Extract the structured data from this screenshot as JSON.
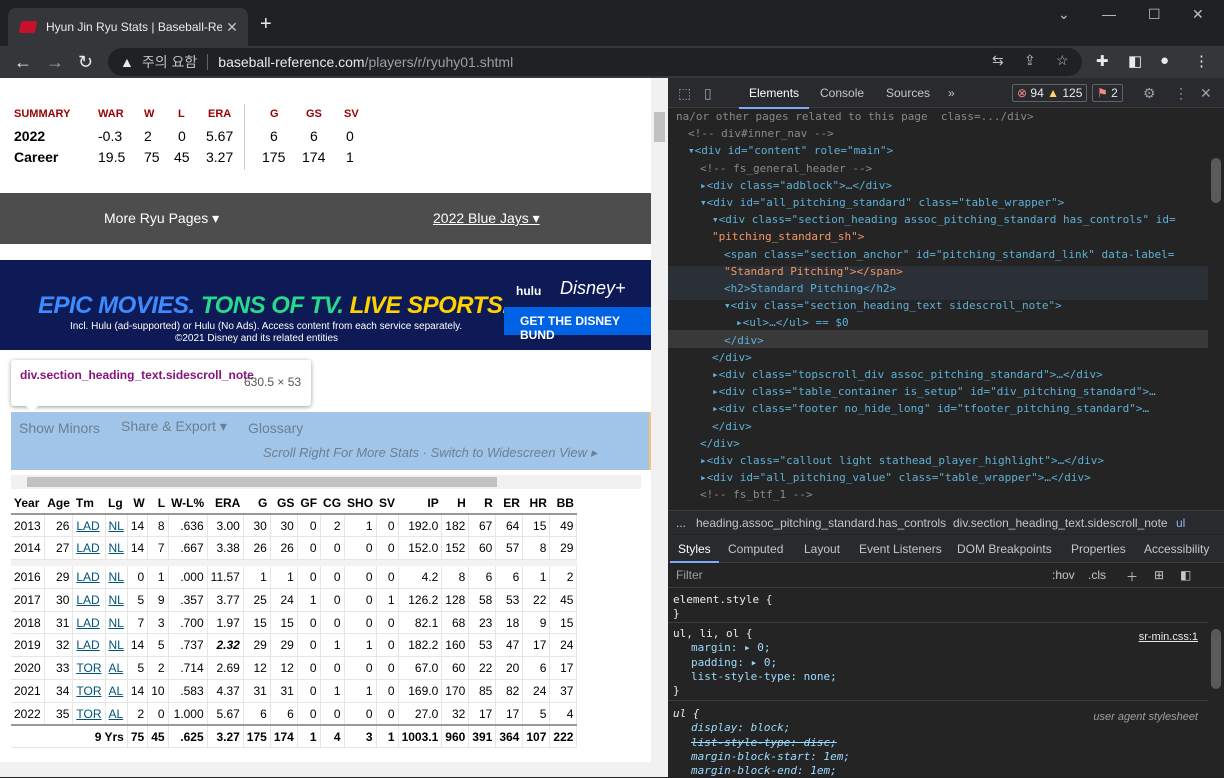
{
  "browser": {
    "tab_title": "Hyun Jin Ryu Stats | Baseball-Re",
    "new_tab": "+",
    "security_label": "주의 요함",
    "url_domain": "baseball-reference.com",
    "url_path": "/players/r/ryuhy01.shtml"
  },
  "summary": {
    "headers": [
      "SUMMARY",
      "WAR",
      "W",
      "L",
      "ERA",
      "G",
      "GS",
      "SV"
    ],
    "rows": [
      [
        "2022",
        "-0.3",
        "2",
        "0",
        "5.67",
        "6",
        "6",
        "0"
      ],
      [
        "Career",
        "19.5",
        "75",
        "45",
        "3.27",
        "175",
        "174",
        "1"
      ]
    ]
  },
  "more": {
    "ryu": "More Ryu Pages ▾",
    "team": "2022 Blue Jays ▾"
  },
  "ad": {
    "epic": "EPIC MOVIES.",
    "tv": "TONS OF TV.",
    "sports": "LIVE SPORTS.",
    "sub1": "Incl. Hulu (ad-supported) or Hulu (No Ads). Access content from each service separately.",
    "sub2": "©2021 Disney and its related entities",
    "hulu": "hulu",
    "disney": "Disney+",
    "cta": "GET THE DISNEY BUND"
  },
  "tooltip": {
    "selector": "div.section_heading_text.sidescroll_note",
    "size": "630.5 × 53"
  },
  "section": {
    "show_minors": "Show Minors",
    "share": "Share & Export ▾",
    "glossary": "Glossary",
    "scroll_note": "Scroll Right For More Stats · Switch to Widescreen View  ▸"
  },
  "table": {
    "headers": [
      "Year",
      "Age",
      "Tm",
      "Lg",
      "W",
      "L",
      "W-L%",
      "ERA",
      "G",
      "GS",
      "GF",
      "CG",
      "SHO",
      "SV",
      "IP",
      "H",
      "R",
      "ER",
      "HR",
      "BB"
    ],
    "rows": [
      [
        "2013",
        "26",
        "LAD",
        "NL",
        "14",
        "8",
        ".636",
        "3.00",
        "30",
        "30",
        "0",
        "2",
        "1",
        "0",
        "192.0",
        "182",
        "67",
        "64",
        "15",
        "49"
      ],
      [
        "2014",
        "27",
        "LAD",
        "NL",
        "14",
        "7",
        ".667",
        "3.38",
        "26",
        "26",
        "0",
        "0",
        "0",
        "0",
        "152.0",
        "152",
        "60",
        "57",
        "8",
        "29"
      ],
      [
        "2016",
        "29",
        "LAD",
        "NL",
        "0",
        "1",
        ".000",
        "11.57",
        "1",
        "1",
        "0",
        "0",
        "0",
        "0",
        "4.2",
        "8",
        "6",
        "6",
        "1",
        "2"
      ],
      [
        "2017",
        "30",
        "LAD",
        "NL",
        "5",
        "9",
        ".357",
        "3.77",
        "25",
        "24",
        "1",
        "0",
        "0",
        "1",
        "126.2",
        "128",
        "58",
        "53",
        "22",
        "45"
      ],
      [
        "2018",
        "31",
        "LAD",
        "NL",
        "7",
        "3",
        ".700",
        "1.97",
        "15",
        "15",
        "0",
        "0",
        "0",
        "0",
        "82.1",
        "68",
        "23",
        "18",
        "9",
        "15"
      ],
      [
        "2019",
        "32",
        "LAD",
        "NL",
        "14",
        "5",
        ".737",
        "2.32",
        "29",
        "29",
        "0",
        "1",
        "1",
        "0",
        "182.2",
        "160",
        "53",
        "47",
        "17",
        "24"
      ],
      [
        "2020",
        "33",
        "TOR",
        "AL",
        "5",
        "2",
        ".714",
        "2.69",
        "12",
        "12",
        "0",
        "0",
        "0",
        "0",
        "67.0",
        "60",
        "22",
        "20",
        "6",
        "17"
      ],
      [
        "2021",
        "34",
        "TOR",
        "AL",
        "14",
        "10",
        ".583",
        "4.37",
        "31",
        "31",
        "0",
        "1",
        "1",
        "0",
        "169.0",
        "170",
        "85",
        "82",
        "24",
        "37"
      ],
      [
        "2022",
        "35",
        "TOR",
        "AL",
        "2",
        "0",
        "1.000",
        "5.67",
        "6",
        "6",
        "0",
        "0",
        "0",
        "0",
        "27.0",
        "32",
        "17",
        "17",
        "5",
        "4"
      ]
    ],
    "totals": [
      "9 Yrs",
      "75",
      "45",
      ".625",
      "3.27",
      "175",
      "174",
      "1",
      "4",
      "3",
      "1",
      "1003.1",
      "960",
      "391",
      "364",
      "107",
      "222"
    ]
  },
  "devtools": {
    "tabs": [
      "Elements",
      "Console",
      "Sources",
      "»"
    ],
    "errors": "94",
    "warnings": "125",
    "issues": "2",
    "lines": [
      {
        "i": 0,
        "t": "na/or other pages related to this page  class=.../div>",
        "k": "cm"
      },
      {
        "i": 1,
        "t": "<!-- div#inner_nav -->",
        "k": "cm"
      },
      {
        "i": 1,
        "t": "▾<div id=\"content\" role=\"main\">",
        "k": "tg"
      },
      {
        "i": 2,
        "t": "<!-- fs_general_header -->",
        "k": "cm"
      },
      {
        "i": 2,
        "t": "▸<div class=\"adblock\">…</div>",
        "k": "tg"
      },
      {
        "i": 2,
        "t": "▾<div id=\"all_pitching_standard\" class=\"table_wrapper\">",
        "k": "tg"
      },
      {
        "i": 3,
        "t": "▾<div class=\"section_heading assoc_pitching_standard has_controls\" id=",
        "k": "tg"
      },
      {
        "i": 3,
        "t": "\"pitching_standard_sh\">",
        "k": "av"
      },
      {
        "i": 4,
        "t": "<span class=\"section_anchor\" id=\"pitching_standard_link\" data-label=",
        "k": "tg"
      },
      {
        "i": 4,
        "t": "\"Standard Pitching\"></span>",
        "k": "av"
      },
      {
        "i": 4,
        "t": "<h2>Standard Pitching</h2>",
        "k": "tg"
      },
      {
        "i": 4,
        "t": "▾<div class=\"section_heading_text sidescroll_note\">",
        "k": "tg"
      },
      {
        "i": 5,
        "t": "▸<ul>…</ul> == $0",
        "k": "tg"
      },
      {
        "i": 4,
        "t": "</div>",
        "k": "tg"
      },
      {
        "i": 3,
        "t": "</div>",
        "k": "tg"
      },
      {
        "i": 3,
        "t": "▸<div class=\"topscroll_div assoc_pitching_standard\">…</div>",
        "k": "tg"
      },
      {
        "i": 3,
        "t": "▸<div class=\"table_container is_setup\" id=\"div_pitching_standard\">…",
        "k": "tg"
      },
      {
        "i": 3,
        "t": "▸<div class=\"footer no_hide_long\" id=\"tfooter_pitching_standard\">…",
        "k": "tg"
      },
      {
        "i": 3,
        "t": "</div>",
        "k": "tg"
      },
      {
        "i": 2,
        "t": "</div>",
        "k": "tg"
      },
      {
        "i": 2,
        "t": "▸<div class=\"callout light stathead_player_highlight\">…</div>",
        "k": "tg"
      },
      {
        "i": 2,
        "t": "▸<div id=\"all_pitching_value\" class=\"table_wrapper\">…</div>",
        "k": "tg"
      },
      {
        "i": 2,
        "t": "<!-- fs_btf_1 -->",
        "k": "cm"
      }
    ],
    "crumbs": [
      "...",
      "heading.assoc_pitching_standard.has_controls",
      "div.section_heading_text.sidescroll_note",
      "ul"
    ],
    "style_tabs": [
      "Styles",
      "Computed",
      "Layout",
      "Event Listeners",
      "DOM Breakpoints",
      "Properties",
      "Accessibility"
    ],
    "filter": "Filter",
    "hov": ":hov",
    ".cls": ".cls",
    "rules": {
      "r1_sel": "element.style {",
      "r1_end": "}",
      "r2_sel": "ul, li, ol {",
      "r2_src": "sr-min.css:1",
      "r2_p1": "margin: ▸ 0;",
      "r2_p2": "padding: ▸ 0;",
      "r2_p3": "list-style-type: none;",
      "r2_end": "}",
      "r3_sel": "ul {",
      "r3_src": "user agent stylesheet",
      "r3_p1": "display: block;",
      "r3_p2": "list-style-type: disc;",
      "r3_p3": "margin-block-start: 1em;",
      "r3_p4": "margin-block-end: 1em;"
    }
  }
}
